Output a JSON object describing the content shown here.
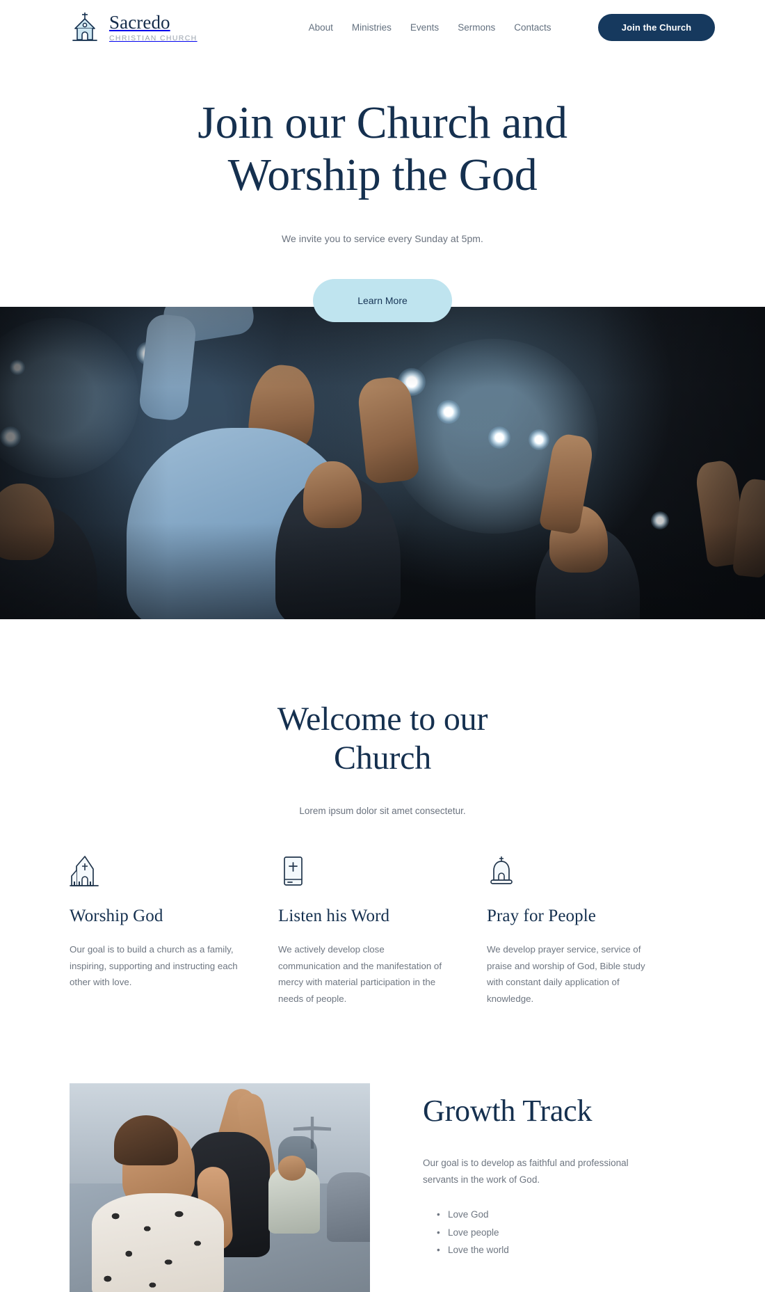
{
  "brand": {
    "name": "Sacredo",
    "tagline": "CHRISTIAN CHURCH",
    "logo_icon": "church-building-icon"
  },
  "header": {
    "nav": [
      {
        "label": "About"
      },
      {
        "label": "Ministries"
      },
      {
        "label": "Events"
      },
      {
        "label": "Sermons"
      },
      {
        "label": "Contacts"
      }
    ],
    "cta_label": "Join the Church"
  },
  "hero": {
    "title_line_1": "Join our Church and",
    "title_line_2": "Worship the God",
    "subtitle": "We invite you to service every Sunday at 5pm.",
    "button_label": "Learn More",
    "photo_alt": "congregation worshipping with raised hands under stage lights"
  },
  "welcome": {
    "title_line_1": "Welcome to our",
    "title_line_2": "Church",
    "subtitle": "Lorem ipsum dolor sit amet consectetur."
  },
  "features": [
    {
      "icon": "church-building-icon",
      "title": "Worship God",
      "body": "Our goal is to build a church as a family, inspiring, supporting and instructing each other with love."
    },
    {
      "icon": "bible-book-icon",
      "title": "Listen his Word",
      "body": "We actively develop close communication and the manifestation of mercy with material participation in the needs of people."
    },
    {
      "icon": "church-bell-icon",
      "title": "Pray for People",
      "body": "We develop prayer service, service of praise and worship of God, Bible study with constant daily application of knowledge."
    }
  ],
  "growth": {
    "title": "Growth Track",
    "body": "Our goal is to develop as faithful and professional servants in the work of God.",
    "list": [
      "Love God",
      "Love people",
      "Love the world"
    ],
    "photo_alt": "woman praying with hands clasped among a congregation"
  },
  "colors": {
    "navy": "#15304f",
    "navy_button": "#16395e",
    "light_blue": "#bfe4ef",
    "body_text": "#6e7681",
    "muted": "#9aa3ae",
    "white": "#ffffff"
  }
}
